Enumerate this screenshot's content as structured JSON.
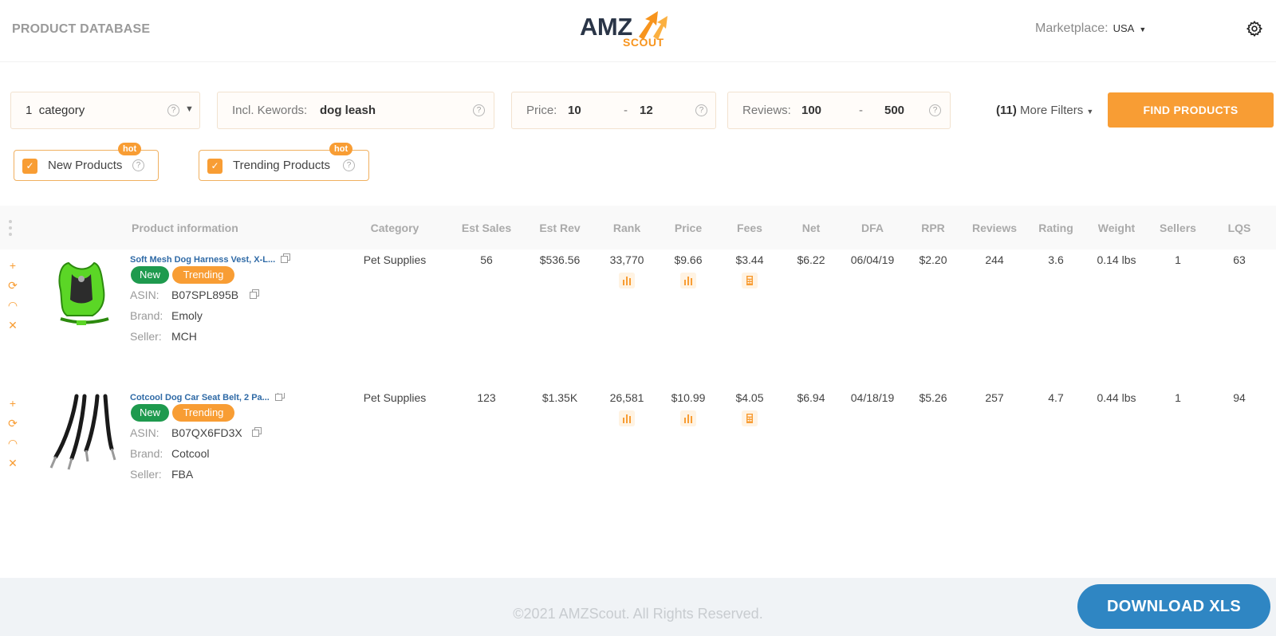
{
  "header": {
    "page_title": "PRODUCT DATABASE",
    "logo_top": "AMZ",
    "logo_bottom": "SCOUT",
    "marketplace_label": "Marketplace:",
    "marketplace_value": "USA"
  },
  "filters": {
    "category_count": "1",
    "category_label": "category",
    "keywords_label": "Incl. Kewords:",
    "keywords_value": "dog leash",
    "price_label": "Price:",
    "price_min": "10",
    "price_max": "12",
    "reviews_label": "Reviews:",
    "reviews_min": "100",
    "reviews_max": "500",
    "range_sep": "-",
    "more_count": "(11)",
    "more_label": "More Filters",
    "find_button": "FIND PRODUCTS",
    "new_products": "New Products",
    "trending_products": "Trending Products",
    "hot_label": "hot"
  },
  "table": {
    "headers": {
      "product": "Product information",
      "category": "Category",
      "est_sales": "Est Sales",
      "est_rev": "Est Rev",
      "rank": "Rank",
      "price": "Price",
      "fees": "Fees",
      "net": "Net",
      "dfa": "DFA",
      "rpr": "RPR",
      "reviews": "Reviews",
      "rating": "Rating",
      "weight": "Weight",
      "sellers": "Sellers",
      "lqs": "LQS"
    },
    "labels": {
      "asin": "ASIN:",
      "brand": "Brand:",
      "seller": "Seller:",
      "new": "New",
      "trending": "Trending"
    },
    "rows": [
      {
        "title": "Soft Mesh Dog Harness Vest, X-L...",
        "asin": "B07SPL895B",
        "brand": "Emoly",
        "seller": "MCH",
        "category": "Pet Supplies",
        "est_sales": "56",
        "est_rev": "$536.56",
        "rank": "33,770",
        "price": "$9.66",
        "fees": "$3.44",
        "net": "$6.22",
        "dfa": "06/04/19",
        "rpr": "$2.20",
        "reviews": "244",
        "rating": "3.6",
        "weight": "0.14 lbs",
        "sellers": "1",
        "lqs": "63"
      },
      {
        "title": "Cotcool Dog Car Seat Belt, 2 Pa...",
        "asin": "B07QX6FD3X",
        "brand": "Cotcool",
        "seller": "FBA",
        "category": "Pet Supplies",
        "est_sales": "123",
        "est_rev": "$1.35K",
        "rank": "26,581",
        "price": "$10.99",
        "fees": "$4.05",
        "net": "$6.94",
        "dfa": "04/18/19",
        "rpr": "$5.26",
        "reviews": "257",
        "rating": "4.7",
        "weight": "0.44 lbs",
        "sellers": "1",
        "lqs": "94"
      }
    ]
  },
  "footer": {
    "copyright": "©2021 AMZScout. All Rights Reserved.",
    "download_button": "DOWNLOAD XLS"
  },
  "colors": {
    "accent": "#f89d34",
    "link": "#2f6aa6",
    "new_badge": "#1e9a4e",
    "download": "#2f86c3"
  }
}
